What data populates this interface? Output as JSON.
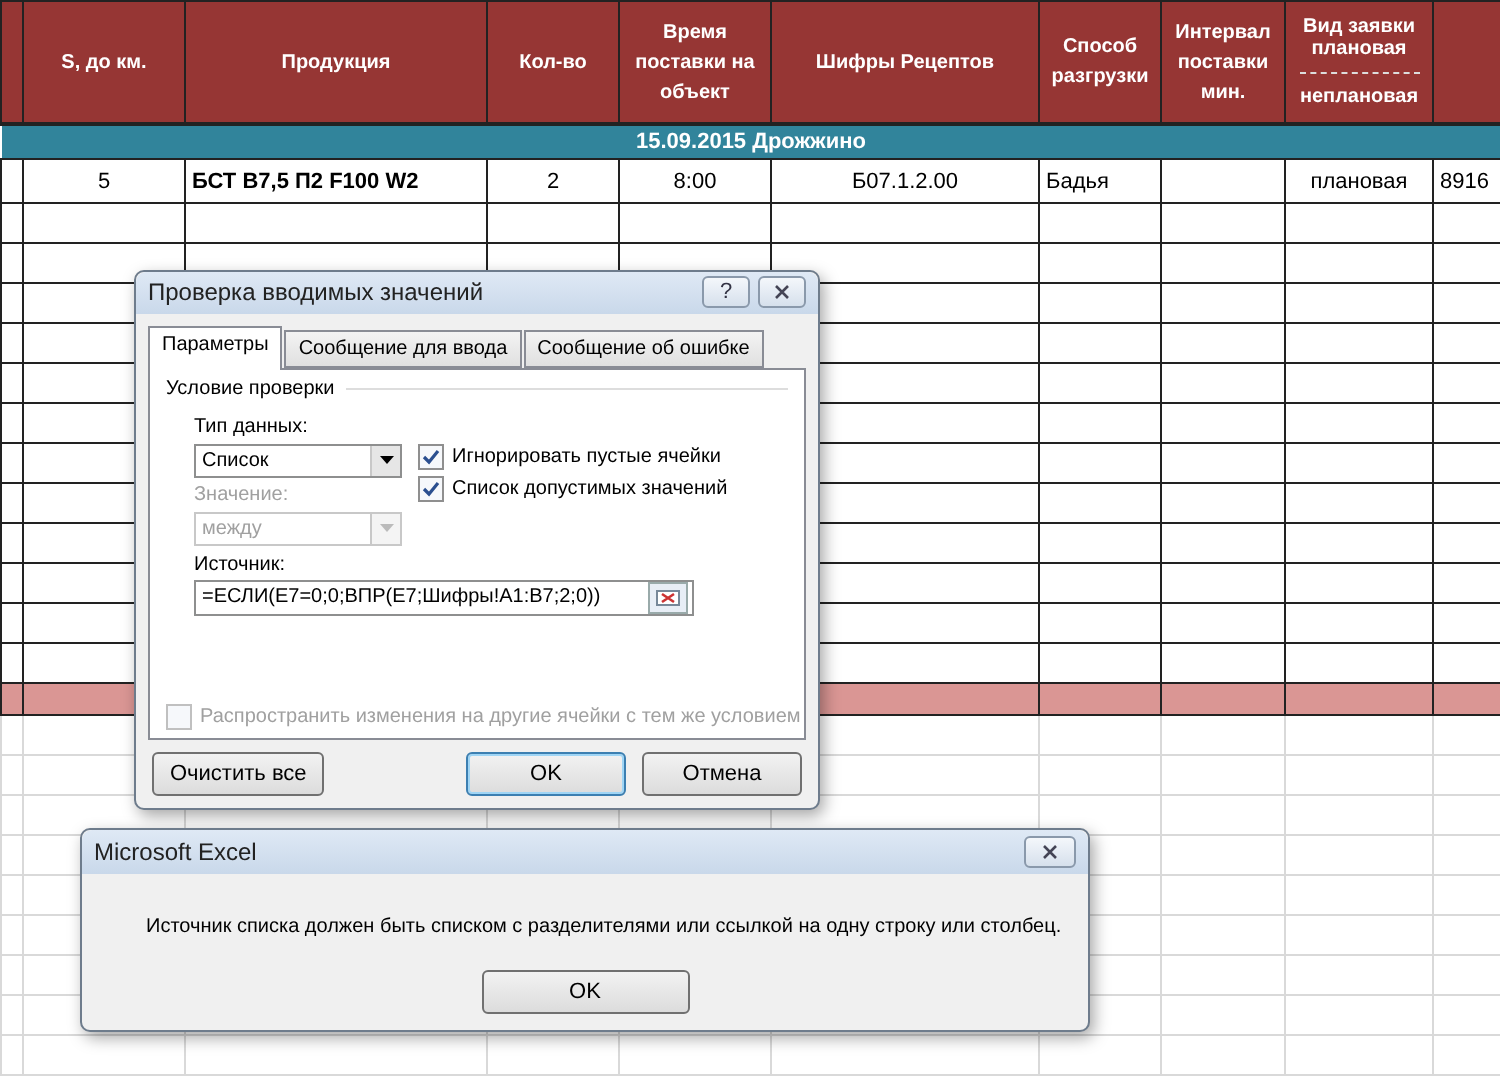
{
  "sheet": {
    "columns": [
      {
        "kind": "blank"
      },
      {
        "kind": "text",
        "label": "S, до км."
      },
      {
        "kind": "text",
        "label": "Продукция"
      },
      {
        "kind": "text",
        "label": "Кол-во"
      },
      {
        "kind": "text",
        "label": "Время поставки на объект"
      },
      {
        "kind": "text",
        "label": "Шифры Рецептов"
      },
      {
        "kind": "text",
        "label": "Способ разгрузки"
      },
      {
        "kind": "text",
        "label": "Интервал поставки мин."
      },
      {
        "kind": "split",
        "label": "Вид заявки",
        "options": [
          "плановая",
          "неплановая"
        ]
      },
      {
        "kind": "blank"
      }
    ],
    "band": {
      "date": "15.09.2015",
      "place": "Дрожжино"
    },
    "rows": [
      {
        "cells": [
          null,
          {
            "text": "5"
          },
          {
            "text": "БСТ В7,5 П2 F100 W2",
            "bold": true
          },
          {
            "text": "2"
          },
          {
            "text": "8:00"
          },
          {
            "text": "Б07.1.2.00"
          },
          {
            "text": "Бадья"
          },
          null,
          {
            "text": "плановая"
          },
          {
            "text": "8916"
          }
        ]
      }
    ]
  },
  "validation_dialog": {
    "title": "Проверка вводимых значений",
    "help": "?",
    "tabs": [
      {
        "label": "Параметры",
        "selected": true
      },
      {
        "label": "Сообщение для ввода",
        "selected": false
      },
      {
        "label": "Сообщение об ошибке",
        "selected": false
      }
    ],
    "group_title": "Условие проверки",
    "data_type": {
      "label": "Тип данных:",
      "value": "Список",
      "disabled": false
    },
    "checkboxes": [
      {
        "label": "Игнорировать пустые ячейки",
        "checked": true
      },
      {
        "label": "Список допустимых значений",
        "checked": true
      }
    ],
    "value": {
      "label": "Значение:",
      "value": "между",
      "disabled": true
    },
    "source": {
      "label": "Источник:",
      "value": "=ЕСЛИ(E7=0;0;ВПР(E7;Шифры!A1:B7;2;0))"
    },
    "propagate": {
      "label": "Распространить изменения на другие ячейки с тем же условием",
      "checked": false,
      "disabled": true
    },
    "buttons": [
      {
        "label": "Очистить все",
        "kind": "left",
        "default": false
      },
      {
        "label": "OK",
        "kind": "right",
        "default": true
      },
      {
        "label": "Отмена",
        "kind": "right",
        "default": false
      }
    ]
  },
  "alert": {
    "title": "Microsoft Excel",
    "message": "Источник списка должен быть списком с разделителями или ссылкой на одну строку или столбец.",
    "button": "OK"
  }
}
